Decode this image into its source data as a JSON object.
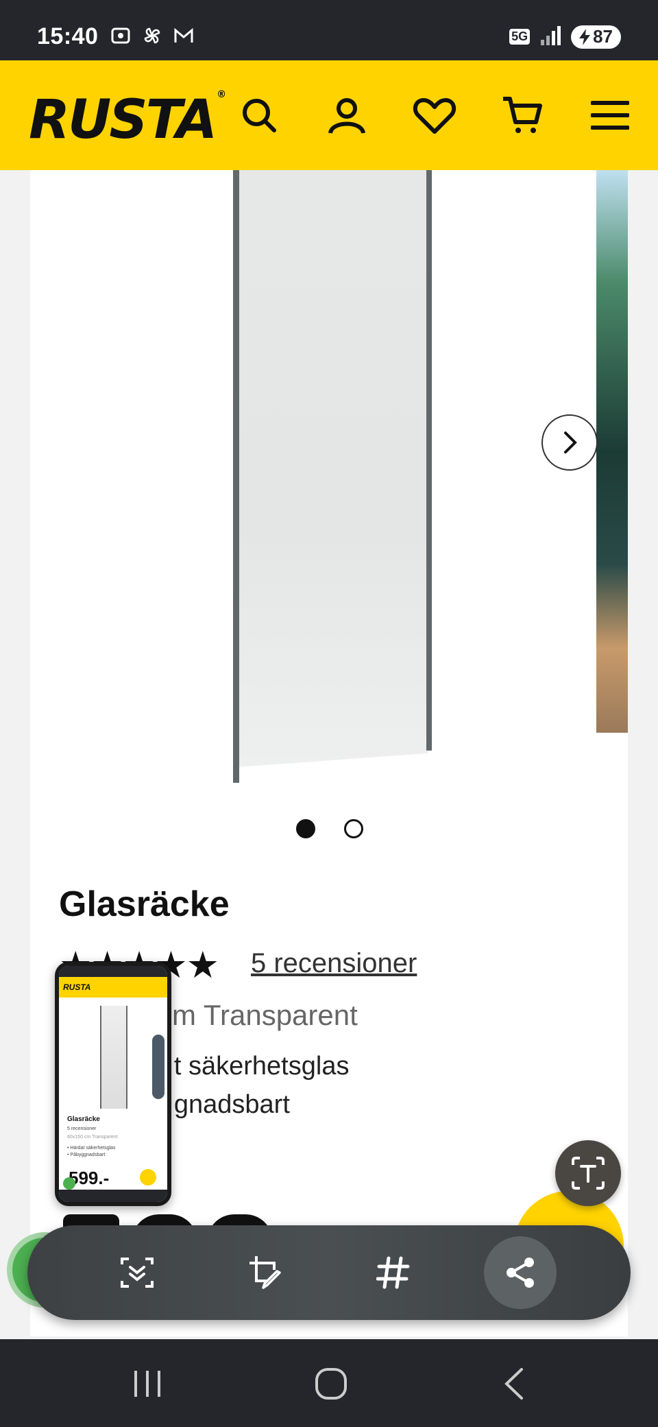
{
  "status_bar": {
    "time": "15:40",
    "network": "5G",
    "battery": "87",
    "icons_left": [
      "screenshot-icon",
      "pinwheel-icon",
      "gmail-icon"
    ]
  },
  "header": {
    "logo": "RUSTA",
    "logo_mark": "®",
    "icons": [
      "search-icon",
      "account-icon",
      "heart-icon",
      "cart-icon",
      "menu-icon"
    ],
    "accent_color": "#ffd300"
  },
  "product": {
    "title": "Glasräcke",
    "rating_stars": "★★★★★",
    "rating": 5,
    "rating_max": 5,
    "reviews_link": "5 recensioner",
    "variant_visible": "cm Transparent",
    "bullets_visible": [
      "t säkerhetsglas",
      "gnadsbart"
    ],
    "carousel": {
      "slides": 2,
      "active": 1
    }
  },
  "thumbnail": {
    "logo": "RUSTA",
    "title": "Glasräcke",
    "reviews": "5 recensioner",
    "variant": "60x150 cm Transparent",
    "bullet_1": "• Härdat säkerhetsglas",
    "bullet_2": "• Påbyggnadsbart",
    "price": "599.-"
  },
  "toolbar": {
    "items": [
      "scroll-capture-icon",
      "edit-crop-icon",
      "hashtag-icon",
      "share-icon"
    ]
  },
  "navbar": {
    "items": [
      "recent-apps-icon",
      "home-icon",
      "back-icon"
    ]
  }
}
